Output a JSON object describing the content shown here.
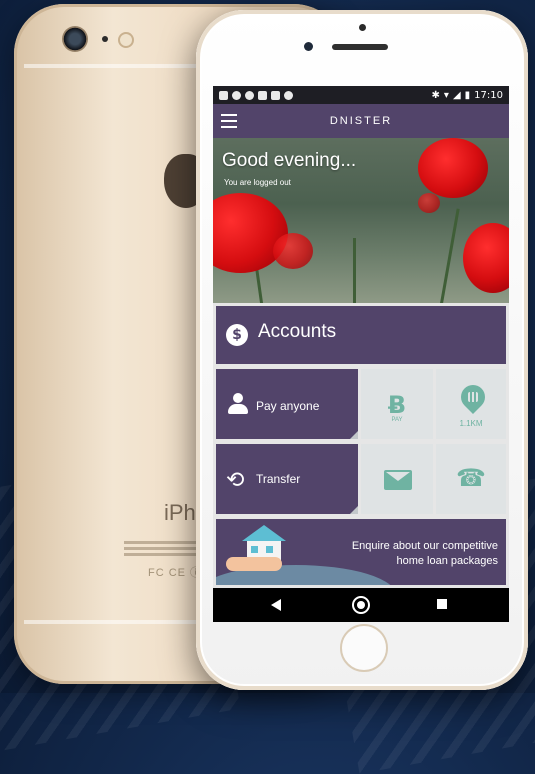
{
  "status_bar": {
    "time": "17:10"
  },
  "app_bar": {
    "title": "DNISTER"
  },
  "hero": {
    "greeting": "Good evening...",
    "login_status": "You are logged out"
  },
  "tiles": {
    "accounts": {
      "icon": "$",
      "label": "Accounts"
    },
    "pay_anyone": {
      "label": "Pay anyone"
    },
    "transfer": {
      "label": "Transfer"
    },
    "pay": {
      "icon": "Ƀ",
      "sub": "PAY"
    },
    "location": {
      "label": "1.1KM"
    },
    "mail": {
      "icon": "mail-icon"
    },
    "phone": {
      "icon": "☎"
    }
  },
  "promo": {
    "line1": "Enquire about our competitive",
    "line2": "home loan packages"
  },
  "back_phone": {
    "text": "iPhone",
    "cert": "FC CE ⓘ"
  },
  "colors": {
    "primary": "#52446a",
    "accent": "#6fb3a2",
    "tile_grey": "#dfe3e4"
  },
  "icons": [
    "menu-icon",
    "dollar-icon",
    "person-icon",
    "transfer-icon",
    "bitcoin-icon",
    "location-pin-icon",
    "mail-icon",
    "phone-icon",
    "nav-back-icon",
    "nav-home-icon",
    "nav-recent-icon"
  ]
}
